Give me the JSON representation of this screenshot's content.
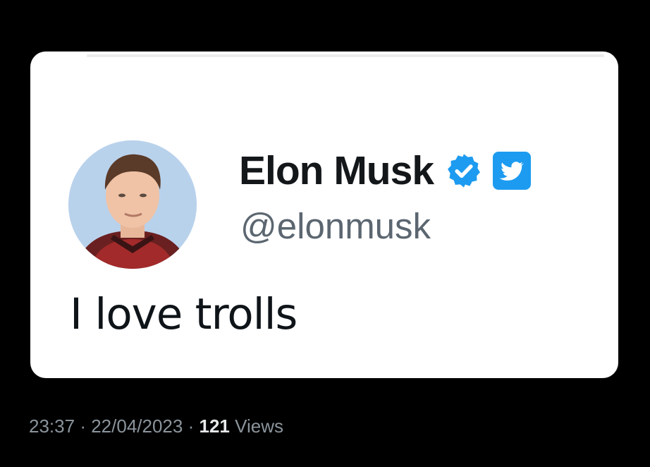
{
  "tweet": {
    "author": {
      "display_name": "Elon Musk",
      "handle": "@elonmusk",
      "verified": true,
      "avatar_icon": "profile-photo",
      "verified_icon": "verified-badge-icon",
      "platform_icon": "twitter-bird-icon"
    },
    "text": "I love trolls"
  },
  "meta": {
    "time": "23:37",
    "separator": "·",
    "date": "22/04/2023",
    "views_count": "121",
    "views_label": "Views"
  },
  "colors": {
    "background": "#000000",
    "card": "#ffffff",
    "accent": "#1d9bf0",
    "name": "#14171a",
    "handle": "#5b6670",
    "meta": "#8b949c"
  }
}
